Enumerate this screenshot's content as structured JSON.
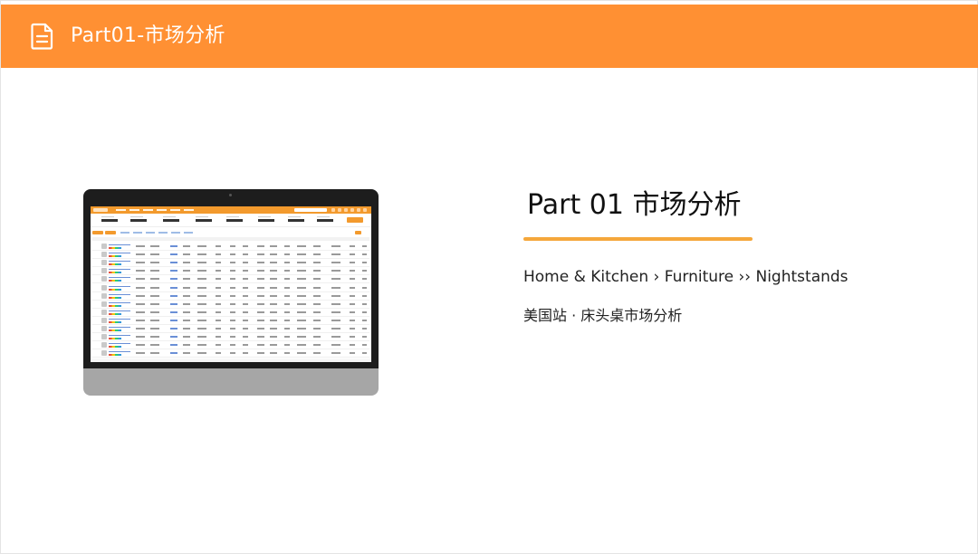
{
  "header": {
    "title": "Part01-市场分析",
    "icon": "document-icon",
    "bg_color": "#ff9033"
  },
  "main": {
    "title": "Part 01  市场分析",
    "breadcrumb": "Home & Kitchen › Furniture ›› Nightstands",
    "subtitle": "美国站 · 床头桌市场分析",
    "accent_color": "#f5a73b"
  }
}
